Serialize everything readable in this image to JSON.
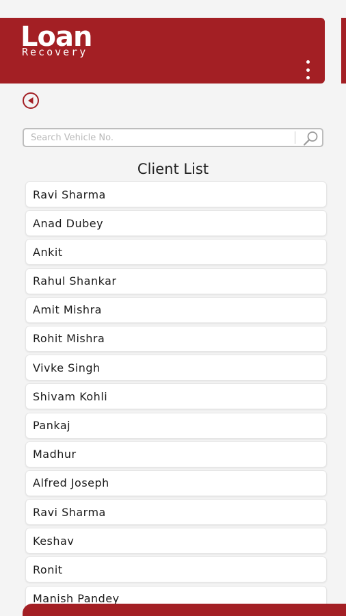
{
  "header": {
    "logo_main": "Loan",
    "logo_sub": "Recovery",
    "brand_color": "#a31f24",
    "menu_icon": "more-vertical-icon"
  },
  "navigation": {
    "back_icon": "back-arrow-icon"
  },
  "search": {
    "placeholder": "Search Vehicle No.",
    "value": "",
    "icon": "search-icon"
  },
  "list": {
    "title": "Client List",
    "clients": [
      "Ravi Sharma",
      "Anad Dubey",
      "Ankit",
      "Rahul Shankar",
      "Amit Mishra",
      "Rohit Mishra",
      "Vivke Singh",
      "Shivam Kohli",
      "Pankaj",
      "Madhur",
      "Alfred Joseph",
      "Ravi Sharma",
      "Keshav",
      "Ronit",
      "Manish Pandey"
    ]
  }
}
